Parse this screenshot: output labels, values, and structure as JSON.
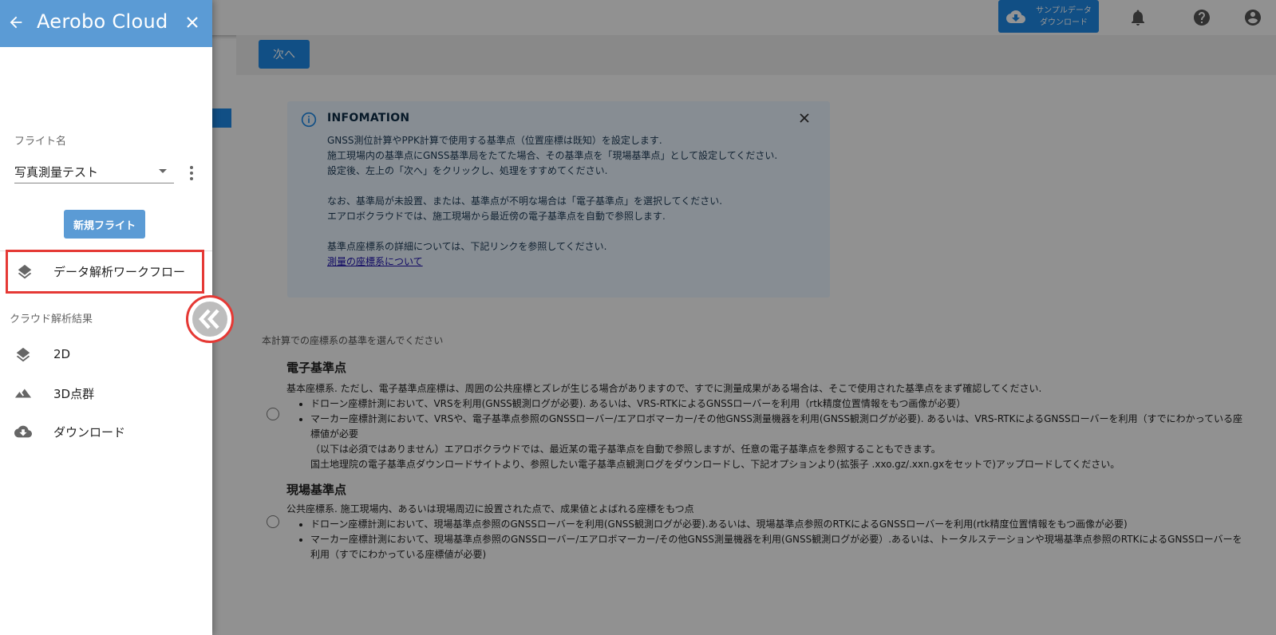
{
  "topbar": {
    "sample_button_line1": "サンプルデータ",
    "sample_button_line2": "ダウンロード"
  },
  "toolbar": {
    "next_label": "次へ"
  },
  "info": {
    "title": "INFOMATION",
    "lines": [
      "GNSS測位計算やPPK計算で使用する基準点（位置座標は既知）を設定します.",
      "施工現場内の基準点にGNSS基準局をたてた場合、その基準点を「現場基準点」として設定してください.",
      "設定後、左上の「次へ」をクリックし、処理をすすめてください.",
      "なお、基準局が未設置、または、基準点が不明な場合は「電子基準点」を選択してください.",
      "エアロボクラウドでは、施工現場から最近傍の電子基準点を自動で参照します.",
      "基準点座標系の詳細については、下記リンクを参照してください."
    ],
    "link_label": "測量の座標系について"
  },
  "selection": {
    "prompt": "本計算での座標系の基準を選んでください",
    "options": [
      {
        "title": "電子基準点",
        "description": "基本座標系. ただし、電子基準点座標は、周囲の公共座標とズレが生じる場合がありますので、すでに測量成果がある場合は、そこで使用された基準点をまず確認してください.",
        "bullets": [
          "ドローン座標計測において、VRSを利用(GNSS観測ログが必要). あるいは、VRS-RTKによるGNSSローバーを利用（rtk精度位置情報をもつ画像が必要）",
          "マーカー座標計測において、VRSや、電子基準点参照のGNSSローバー/エアロボマーカー/その他GNSS測量機器を利用(GNSS観測ログが必要). あるいは、VRS-RTKによるGNSSローバーを利用（すでにわかっている座標値が必要"
        ],
        "notes": [
          "（以下は必須ではありません）エアロボクラウドでは、最近某の電子基準点を自動で参照しますが、任意の電子基準点を参照することもできます。",
          "国土地理院の電子基準点ダウンロードサイトより、参照したい電子基準点観測ログをダウンロードし、下記オプションより(拡張子 .xxo.gz/.xxn.gxをセットで)アップロードしてください。"
        ]
      },
      {
        "title": "現場基準点",
        "description": "公共座標系. 施工現場内、あるいは現場周辺に設置された点で、成果値とよばれる座標をもつ点",
        "bullets": [
          "ドローン座標計測において、現場基準点参照のGNSSローバーを利用(GNSS観測ログが必要).あるいは、現場基準点参照のRTKによるGNSSローバーを利用(rtk精度位置情報をもつ画像が必要)",
          "マーカー座標計測において、現場基準点参照のGNSSローバー/エアロボマーカー/その他GNSS測量機器を利用(GNSS観測ログが必要）.あるいは、トータルステーションや現場基準点参照のRTKによるGNSSローバーを利用（すでにわかっている座標値が必要)"
        ]
      }
    ]
  },
  "drawer": {
    "title": "Aerobo Cloud",
    "flight_label": "フライト名",
    "flight_value": "写真測量テスト",
    "new_flight_label": "新規フライト",
    "workflow_label": "データ解析ワークフロー",
    "section_label": "クラウド解析結果",
    "items": [
      {
        "label": "2D",
        "icon": "layers-icon"
      },
      {
        "label": "3D点群",
        "icon": "terrain-icon"
      },
      {
        "label": "ダウンロード",
        "icon": "cloud-download-icon"
      }
    ]
  },
  "colors": {
    "primary": "#1e88e5",
    "drawer_header": "#5b9bd5",
    "highlight": "#e53935",
    "info_bg": "#e8f3fd"
  }
}
